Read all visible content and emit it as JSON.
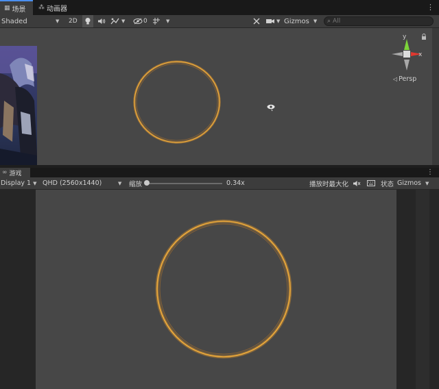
{
  "scene_tab": {
    "label": "场景",
    "icon": "grid-icon"
  },
  "animator_tab": {
    "label": "动画器",
    "icon": "animator-icon"
  },
  "scene_toolbar": {
    "shading_mode": "Shaded",
    "mode_2d": "2D",
    "effects_count": "0",
    "gizmos_label": "Gizmos",
    "search_placeholder": "All"
  },
  "scene_gizmo": {
    "y_label": "y",
    "x_label": "x",
    "persp_label": "Persp",
    "colors": {
      "y": "#7dd43a",
      "x": "#e0382f",
      "center": "#dcdcdc"
    }
  },
  "game_tab": {
    "label": "游戏",
    "icon": "gamepad-icon"
  },
  "game_toolbar": {
    "display": "Display 1",
    "resolution": "QHD (2560x1440)",
    "scale_label": "缩放",
    "scale_value": "0.34x",
    "maximize_label": "播放时最大化",
    "stats_label": "状态",
    "gizmos_label": "Gizmos"
  },
  "colors": {
    "accent": "#4a8ff0",
    "ring": "#e89a2a",
    "scene_bg": "#474747",
    "toolbar_bg": "#3c3c3c"
  }
}
